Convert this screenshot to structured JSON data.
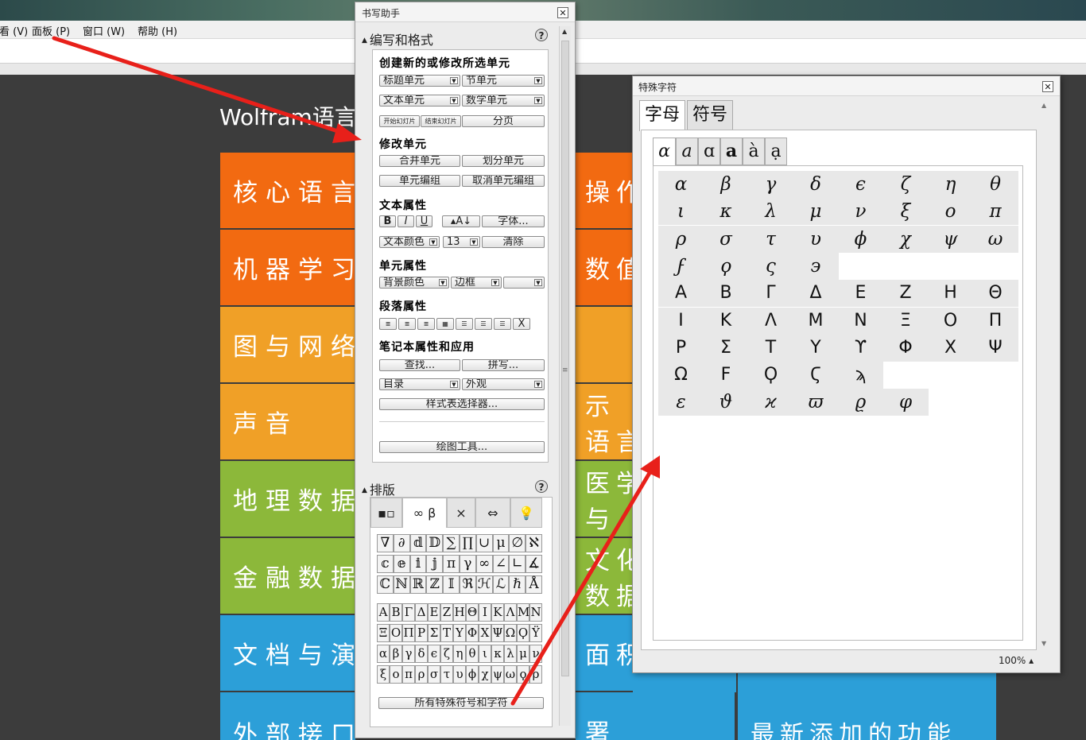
{
  "menubar": {
    "items": [
      "查看 (V)",
      "面板 (P)",
      "窗口 (W)",
      "帮助 (H)"
    ]
  },
  "background": {
    "title": "Wolfram语言",
    "tiles_left": [
      "核心语言",
      "机器学习",
      "图与网络",
      "声音",
      "地理数据",
      "金融数据",
      "文档与演",
      "外部接口"
    ],
    "tiles_right_line1": [
      "操作与",
      "数值",
      "",
      "示",
      "医学",
      "文化",
      "面积",
      "署"
    ],
    "tiles_right_line2": [
      "",
      "",
      "",
      "语言",
      "与",
      "数据",
      "",
      ""
    ],
    "bottom_right_tile": "最新添加的功能",
    "tile_colors": [
      "#f26a11",
      "#f26a11",
      "#f0a027",
      "#f0a027",
      "#8cb83a",
      "#8cb83a",
      "#2c9fd8",
      "#2c9fd8"
    ]
  },
  "writing_assistant": {
    "title": "书写助手",
    "section1": "编写和格式",
    "groups": {
      "create": "创建新的或修改所选单元",
      "modify": "修改单元",
      "text_props": "文本属性",
      "cell_props": "单元属性",
      "para_props": "段落属性",
      "notebook": "笔记本属性和应用"
    },
    "buttons": {
      "title_cell": "标题单元",
      "section_cell": "节单元",
      "text_cell": "文本单元",
      "math_cell": "数学单元",
      "start_slide": "开始幻灯片",
      "end_slide": "结束幻灯片",
      "page_break": "分页",
      "merge": "合并单元",
      "split": "划分单元",
      "group": "单元编组",
      "ungroup": "取消单元编组",
      "bold": "B",
      "italic": "I",
      "underline": "U",
      "font_size_btn": "A",
      "font": "字体...",
      "text_color": "文本颜色",
      "size": "13",
      "clear": "清除",
      "bg_color": "背景颜色",
      "border": "边框",
      "find": "查找...",
      "spell": "拼写...",
      "toc": "目录",
      "appearance": "外观",
      "stylesheet": "样式表选择器...",
      "drawing": "绘图工具...",
      "all_special": "所有特殊符号和字符"
    },
    "section2": "排版",
    "typeset_tabs": [
      "▪▫",
      "∞ β",
      "×",
      "⇔",
      "💡"
    ],
    "glyph_rows": [
      [
        "∇",
        "∂",
        "𝕕",
        "𝔻",
        "∑",
        "∏",
        "∪",
        "μ",
        "∅",
        "ℵ"
      ],
      [
        "𝕔",
        "𝕖",
        "𝕚",
        "𝕛",
        "π",
        "γ",
        "∞",
        "∠",
        "∟",
        "∡"
      ],
      [
        "ℂ",
        "ℕ",
        "ℝ",
        "ℤ",
        "𝕀",
        "ℜ",
        "ℋ",
        "ℒ",
        "ℏ",
        "Å"
      ],
      [
        "Α",
        "Β",
        "Γ",
        "Δ",
        "Ε",
        "Ζ",
        "Η",
        "Θ",
        "Ι",
        "Κ",
        "Λ",
        "Μ",
        "Ν"
      ],
      [
        "Ξ",
        "Ο",
        "Π",
        "Ρ",
        "Σ",
        "Τ",
        "Υ",
        "Φ",
        "Χ",
        "Ψ",
        "Ω",
        "Ϙ",
        "Ϋ"
      ],
      [
        "α",
        "β",
        "γ",
        "δ",
        "ϵ",
        "ζ",
        "η",
        "θ",
        "ι",
        "κ",
        "λ",
        "μ",
        "ν"
      ],
      [
        "ξ",
        "ο",
        "π",
        "ρ",
        "σ",
        "τ",
        "υ",
        "ϕ",
        "χ",
        "ψ",
        "ω",
        "ϙ",
        "ρ"
      ]
    ]
  },
  "special_chars": {
    "title": "特殊字符",
    "tabs": [
      "字母",
      "符号"
    ],
    "style_tabs": [
      "α",
      "a",
      "ɑ",
      "a",
      "à",
      "ạ"
    ],
    "grid_rows": [
      [
        "α",
        "β",
        "γ",
        "δ",
        "ϵ",
        "ζ",
        "η",
        "θ"
      ],
      [
        "ι",
        "κ",
        "λ",
        "μ",
        "ν",
        "ξ",
        "ο",
        "π"
      ],
      [
        "ρ",
        "σ",
        "τ",
        "υ",
        "ϕ",
        "χ",
        "ψ",
        "ω"
      ],
      [
        "ϝ",
        "ϙ",
        "ς",
        "϶"
      ],
      [
        "Α",
        "Β",
        "Γ",
        "Δ",
        "Ε",
        "Ζ",
        "Η",
        "Θ"
      ],
      [
        "Ι",
        "Κ",
        "Λ",
        "Μ",
        "Ν",
        "Ξ",
        "Ο",
        "Π"
      ],
      [
        "Ρ",
        "Σ",
        "Τ",
        "Υ",
        "ϒ",
        "Φ",
        "Χ",
        "Ψ"
      ],
      [
        "Ω",
        "Ϝ",
        "Ϙ",
        "Ϛ",
        "ϡ"
      ],
      [
        "ε",
        "ϑ",
        "ϰ",
        "ϖ",
        "ϱ",
        "φ"
      ]
    ],
    "zoom": "100%"
  },
  "colors": {
    "arrow": "#e8201a",
    "orange": "#f26a11",
    "amber": "#f0a027",
    "green": "#8cb83a",
    "blue": "#2c9fd8"
  }
}
